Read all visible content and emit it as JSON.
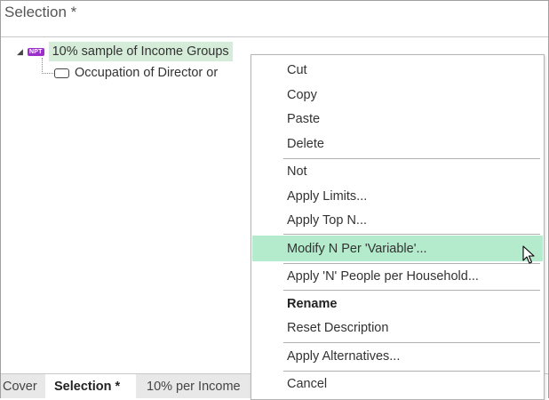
{
  "panel": {
    "title": "Selection *"
  },
  "tree": {
    "root": {
      "badge": "NPT",
      "label": "10% sample of Income Groups"
    },
    "child": {
      "label": "Occupation of Director or"
    }
  },
  "context_menu": {
    "items": [
      {
        "label": "Cut"
      },
      {
        "label": "Copy"
      },
      {
        "label": "Paste"
      },
      {
        "label": "Delete"
      },
      {
        "label": "Not"
      },
      {
        "label": "Apply Limits..."
      },
      {
        "label": "Apply Top N..."
      },
      {
        "label": "Modify N Per 'Variable'..."
      },
      {
        "label": "Apply 'N' People per Household..."
      },
      {
        "label": "Rename"
      },
      {
        "label": "Reset Description"
      },
      {
        "label": "Apply Alternatives..."
      },
      {
        "label": "Cancel"
      }
    ],
    "highlighted_item": "Modify N Per 'Variable'..."
  },
  "tabs": [
    {
      "label": "Cover"
    },
    {
      "label": "Selection *"
    },
    {
      "label": "10% per Income"
    }
  ],
  "colors": {
    "highlight": "#b3ebcc",
    "selected_node": "#d4ecd8",
    "npt_badge": "#9b2fc9"
  }
}
